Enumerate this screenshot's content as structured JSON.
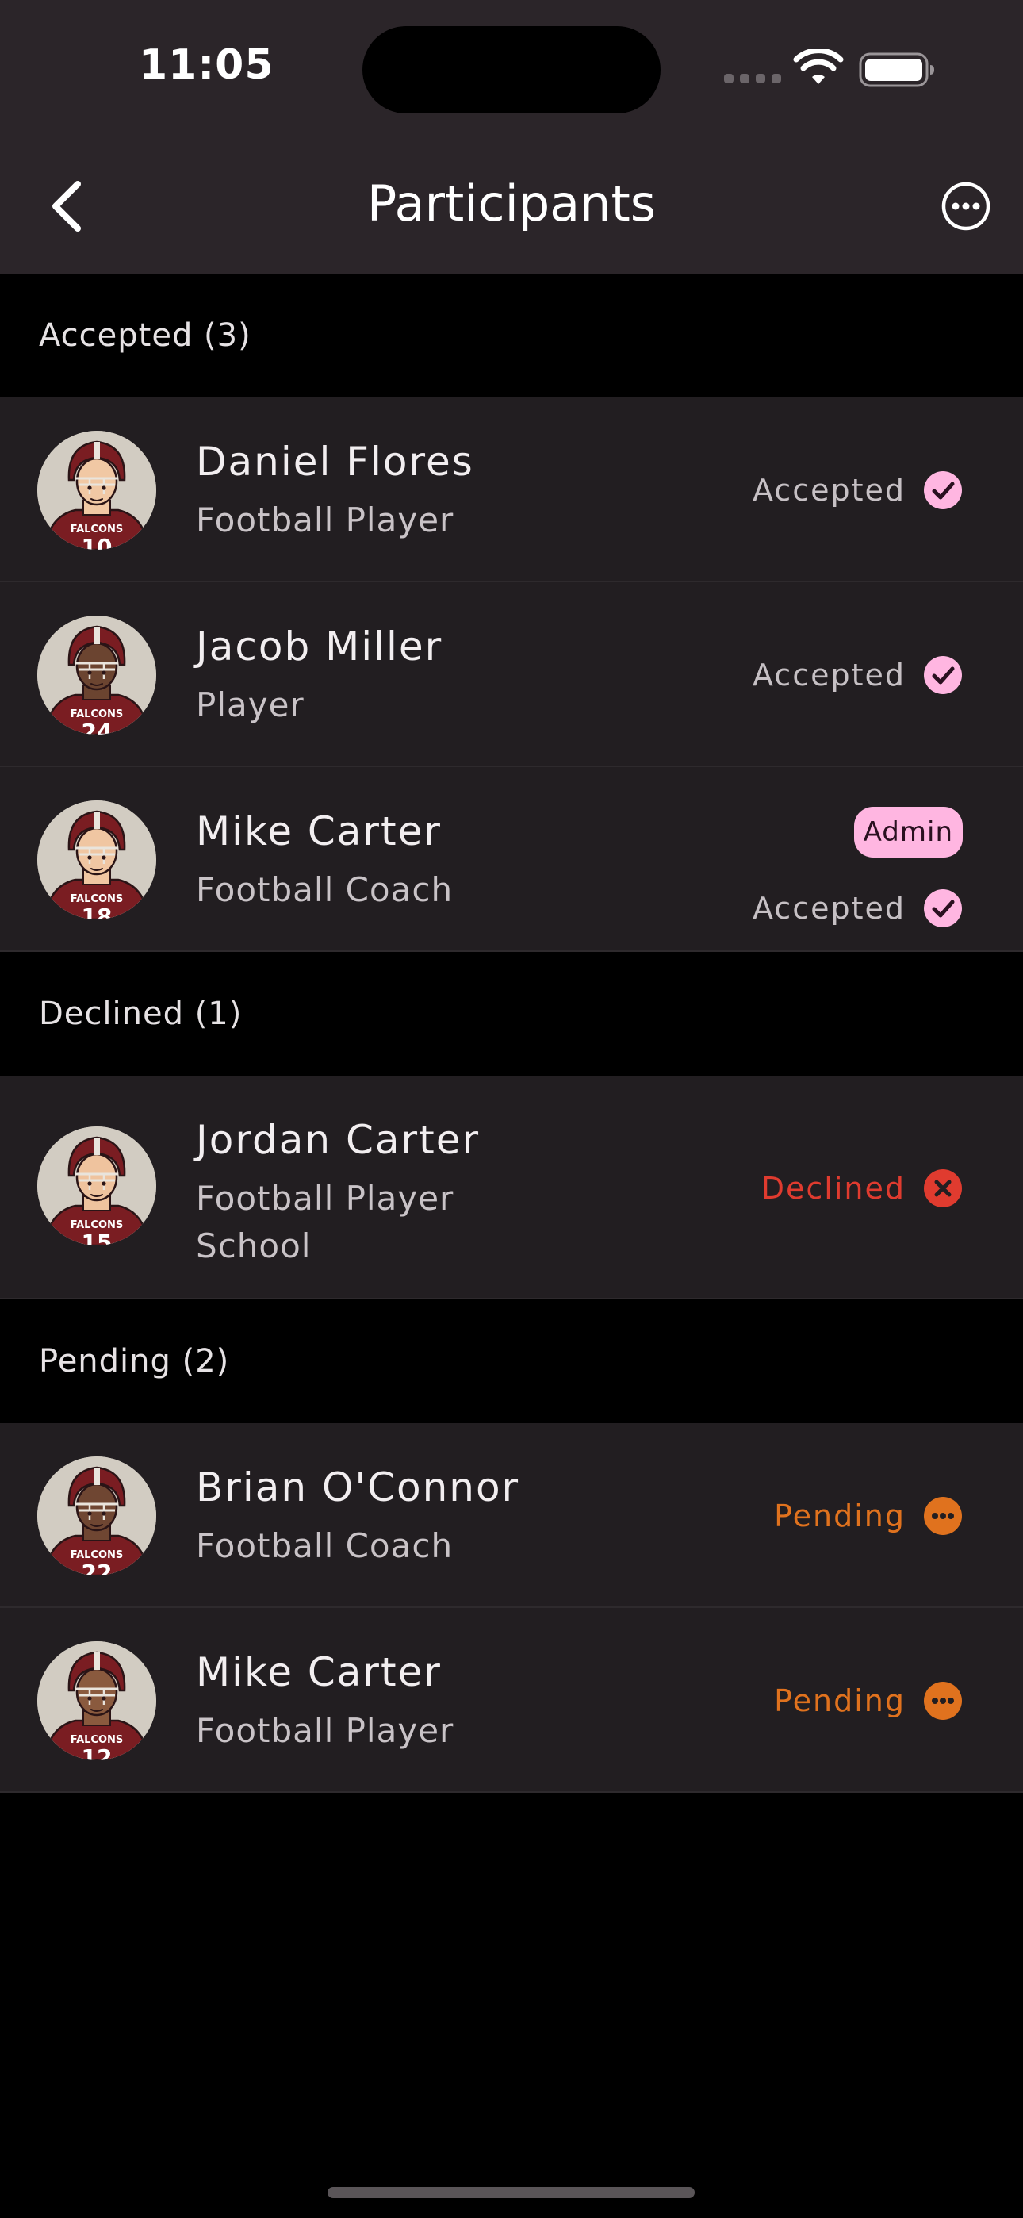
{
  "status_bar": {
    "time": "11:05"
  },
  "nav": {
    "title": "Participants"
  },
  "sections": {
    "accepted": {
      "header": "Accepted (3)",
      "rows": [
        {
          "name": "Daniel Flores",
          "role": "Football Player",
          "status": "Accepted",
          "jersey": "10",
          "skin": "#f1c8a4"
        },
        {
          "name": "Jacob Miller",
          "role": "Player",
          "status": "Accepted",
          "jersey": "24",
          "skin": "#6b4430"
        },
        {
          "name": "Mike Carter",
          "role": "Football Coach",
          "status": "Accepted",
          "badge": "Admin",
          "jersey": "18",
          "skin": "#f0c6a2"
        }
      ]
    },
    "declined": {
      "header": "Declined (1)",
      "rows": [
        {
          "name": "Jordan Carter",
          "role": "Football Player",
          "org": "School",
          "status": "Declined",
          "jersey": "15",
          "skin": "#efc39e"
        }
      ]
    },
    "pending": {
      "header": "Pending (2)",
      "rows": [
        {
          "name": "Brian O'Connor",
          "role": "Football Coach",
          "status": "Pending",
          "jersey": "22",
          "skin": "#6f4632"
        },
        {
          "name": "Mike Carter",
          "role": "Football Player",
          "status": "Pending",
          "jersey": "12",
          "skin": "#8a5a3e"
        }
      ]
    }
  },
  "avatar_label": "FALCONS",
  "colors": {
    "accepted_icon": "#ffb6e1",
    "declined": "#e03b2f",
    "pending": "#e0721e",
    "admin_badge": "#ffb6e1",
    "row_background": "#221e21",
    "header_background": "#2b2529",
    "jersey": "#7a1d22"
  },
  "icons": {
    "back": "chevron-left-icon",
    "more": "ellipsis-circle-icon",
    "accepted": "checkmark-circle-icon",
    "declined": "x-circle-icon",
    "pending": "ellipsis-filled-circle-icon"
  }
}
